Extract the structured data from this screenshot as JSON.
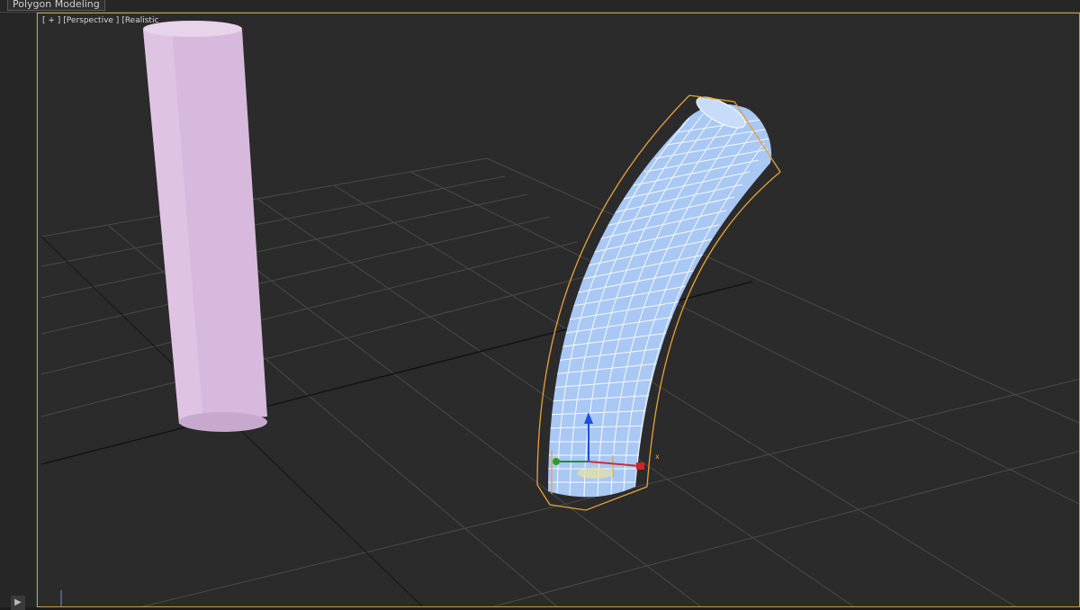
{
  "toolbar": {
    "tab_label": "Polygon Modeling"
  },
  "viewport": {
    "label_plus": "[ + ]",
    "label_view": "[Perspective ]",
    "label_shading": "[Realistic"
  },
  "colors": {
    "viewport_border": "#c7a035",
    "cylinder": "#d6b9dc",
    "bent_tube": "#a9c8f4",
    "selection_box": "#e6a23a",
    "grid": "#4a4a4a"
  },
  "icons": {
    "play": "play-icon"
  }
}
